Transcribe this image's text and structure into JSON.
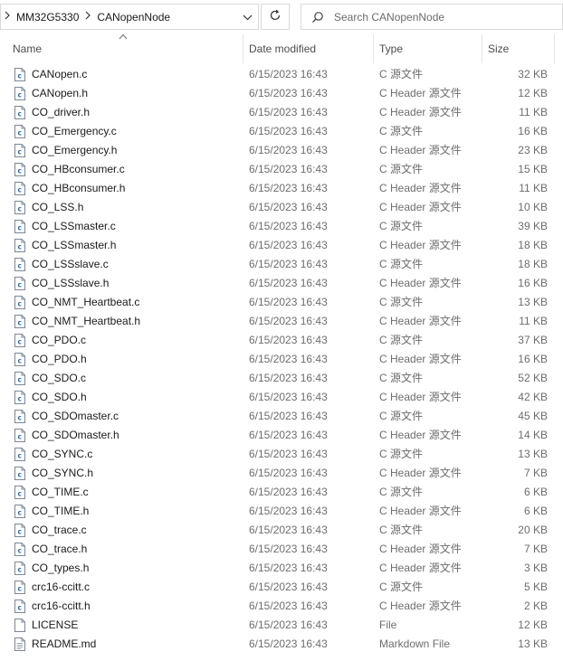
{
  "address": {
    "crumbs": [
      "MM32G5330",
      "CANopenNode"
    ]
  },
  "search": {
    "placeholder": "Search CANopenNode"
  },
  "columns": {
    "name": "Name",
    "date": "Date modified",
    "type": "Type",
    "size": "Size"
  },
  "files": [
    {
      "name": "CANopen.c",
      "date": "6/15/2023 16:43",
      "type": "C 源文件",
      "size": "32 KB",
      "icon": "c-source-file-icon"
    },
    {
      "name": "CANopen.h",
      "date": "6/15/2023 16:43",
      "type": "C Header 源文件",
      "size": "12 KB",
      "icon": "c-header-file-icon"
    },
    {
      "name": "CO_driver.h",
      "date": "6/15/2023 16:43",
      "type": "C Header 源文件",
      "size": "11 KB",
      "icon": "c-header-file-icon"
    },
    {
      "name": "CO_Emergency.c",
      "date": "6/15/2023 16:43",
      "type": "C 源文件",
      "size": "16 KB",
      "icon": "c-source-file-icon"
    },
    {
      "name": "CO_Emergency.h",
      "date": "6/15/2023 16:43",
      "type": "C Header 源文件",
      "size": "23 KB",
      "icon": "c-header-file-icon"
    },
    {
      "name": "CO_HBconsumer.c",
      "date": "6/15/2023 16:43",
      "type": "C 源文件",
      "size": "15 KB",
      "icon": "c-source-file-icon"
    },
    {
      "name": "CO_HBconsumer.h",
      "date": "6/15/2023 16:43",
      "type": "C Header 源文件",
      "size": "11 KB",
      "icon": "c-header-file-icon"
    },
    {
      "name": "CO_LSS.h",
      "date": "6/15/2023 16:43",
      "type": "C Header 源文件",
      "size": "10 KB",
      "icon": "c-header-file-icon"
    },
    {
      "name": "CO_LSSmaster.c",
      "date": "6/15/2023 16:43",
      "type": "C 源文件",
      "size": "39 KB",
      "icon": "c-source-file-icon"
    },
    {
      "name": "CO_LSSmaster.h",
      "date": "6/15/2023 16:43",
      "type": "C Header 源文件",
      "size": "18 KB",
      "icon": "c-header-file-icon"
    },
    {
      "name": "CO_LSSslave.c",
      "date": "6/15/2023 16:43",
      "type": "C 源文件",
      "size": "18 KB",
      "icon": "c-source-file-icon"
    },
    {
      "name": "CO_LSSslave.h",
      "date": "6/15/2023 16:43",
      "type": "C Header 源文件",
      "size": "16 KB",
      "icon": "c-header-file-icon"
    },
    {
      "name": "CO_NMT_Heartbeat.c",
      "date": "6/15/2023 16:43",
      "type": "C 源文件",
      "size": "13 KB",
      "icon": "c-source-file-icon"
    },
    {
      "name": "CO_NMT_Heartbeat.h",
      "date": "6/15/2023 16:43",
      "type": "C Header 源文件",
      "size": "11 KB",
      "icon": "c-header-file-icon"
    },
    {
      "name": "CO_PDO.c",
      "date": "6/15/2023 16:43",
      "type": "C 源文件",
      "size": "37 KB",
      "icon": "c-source-file-icon"
    },
    {
      "name": "CO_PDO.h",
      "date": "6/15/2023 16:43",
      "type": "C Header 源文件",
      "size": "16 KB",
      "icon": "c-header-file-icon"
    },
    {
      "name": "CO_SDO.c",
      "date": "6/15/2023 16:43",
      "type": "C 源文件",
      "size": "52 KB",
      "icon": "c-source-file-icon"
    },
    {
      "name": "CO_SDO.h",
      "date": "6/15/2023 16:43",
      "type": "C Header 源文件",
      "size": "42 KB",
      "icon": "c-header-file-icon"
    },
    {
      "name": "CO_SDOmaster.c",
      "date": "6/15/2023 16:43",
      "type": "C 源文件",
      "size": "45 KB",
      "icon": "c-source-file-icon"
    },
    {
      "name": "CO_SDOmaster.h",
      "date": "6/15/2023 16:43",
      "type": "C Header 源文件",
      "size": "14 KB",
      "icon": "c-header-file-icon"
    },
    {
      "name": "CO_SYNC.c",
      "date": "6/15/2023 16:43",
      "type": "C 源文件",
      "size": "13 KB",
      "icon": "c-source-file-icon"
    },
    {
      "name": "CO_SYNC.h",
      "date": "6/15/2023 16:43",
      "type": "C Header 源文件",
      "size": "7 KB",
      "icon": "c-header-file-icon"
    },
    {
      "name": "CO_TIME.c",
      "date": "6/15/2023 16:43",
      "type": "C 源文件",
      "size": "6 KB",
      "icon": "c-source-file-icon"
    },
    {
      "name": "CO_TIME.h",
      "date": "6/15/2023 16:43",
      "type": "C Header 源文件",
      "size": "6 KB",
      "icon": "c-header-file-icon"
    },
    {
      "name": "CO_trace.c",
      "date": "6/15/2023 16:43",
      "type": "C 源文件",
      "size": "20 KB",
      "icon": "c-source-file-icon"
    },
    {
      "name": "CO_trace.h",
      "date": "6/15/2023 16:43",
      "type": "C Header 源文件",
      "size": "7 KB",
      "icon": "c-header-file-icon"
    },
    {
      "name": "CO_types.h",
      "date": "6/15/2023 16:43",
      "type": "C Header 源文件",
      "size": "3 KB",
      "icon": "c-header-file-icon"
    },
    {
      "name": "crc16-ccitt.c",
      "date": "6/15/2023 16:43",
      "type": "C 源文件",
      "size": "5 KB",
      "icon": "c-source-file-icon"
    },
    {
      "name": "crc16-ccitt.h",
      "date": "6/15/2023 16:43",
      "type": "C Header 源文件",
      "size": "2 KB",
      "icon": "c-header-file-icon"
    },
    {
      "name": "LICENSE",
      "date": "6/15/2023 16:43",
      "type": "File",
      "size": "12 KB",
      "icon": "blank-file-icon"
    },
    {
      "name": "README.md",
      "date": "6/15/2023 16:43",
      "type": "Markdown File",
      "size": "13 KB",
      "icon": "markdown-file-icon"
    }
  ],
  "colors": {
    "code_icon_blue": "#2b6cb0",
    "border": "#d9d9d9",
    "secondary_text": "#6d6d6d"
  }
}
